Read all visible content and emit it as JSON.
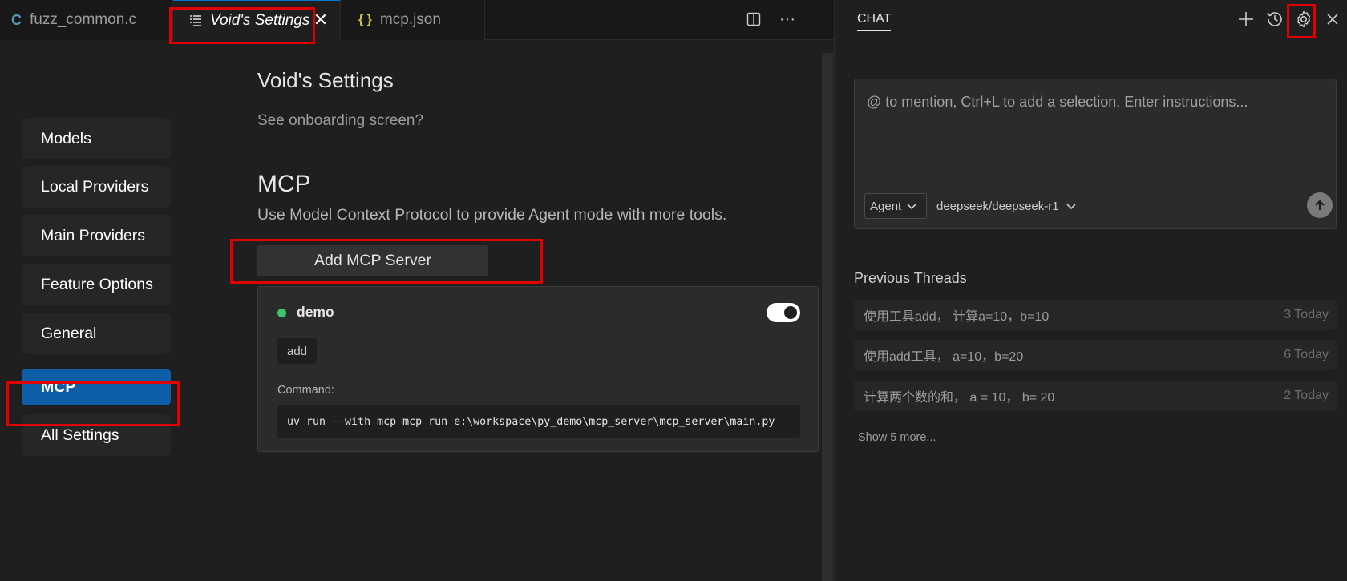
{
  "tabs": [
    {
      "label": "fuzz_common.c",
      "icon": "c-file-icon",
      "glyph": "C"
    },
    {
      "label": "Void's Settings",
      "icon": "settings-list-icon",
      "active": true
    },
    {
      "label": "mcp.json",
      "icon": "json-file-icon",
      "glyph": "{ }"
    }
  ],
  "editor_actions": {
    "split_icon": "split-editor-icon",
    "more_icon": "more-actions-icon",
    "more_glyph": "···"
  },
  "nav": {
    "items": [
      {
        "label": "Models"
      },
      {
        "label": "Local Providers"
      },
      {
        "label": "Main Providers"
      },
      {
        "label": "Feature Options"
      },
      {
        "label": "General"
      },
      {
        "label": "MCP",
        "active": true
      },
      {
        "label": "All Settings"
      }
    ]
  },
  "settings": {
    "title": "Void's Settings",
    "onboarding_link": "See onboarding screen?",
    "mcp_heading": "MCP",
    "mcp_description": "Use Model Context Protocol to provide Agent mode with more tools.",
    "add_button": "Add MCP Server",
    "server": {
      "name": "demo",
      "status_color": "#3ec46d",
      "enabled": true,
      "tools": [
        "add"
      ],
      "command_label": "Command:",
      "command": "uv run --with mcp mcp run e:\\workspace\\py_demo\\mcp_server\\mcp_server\\main.py"
    }
  },
  "chat": {
    "tab_label": "CHAT",
    "actions": [
      "new-chat-icon",
      "history-icon",
      "settings-gear-icon",
      "close-icon"
    ],
    "composer": {
      "placeholder": "@ to mention, Ctrl+L to add a selection. Enter instructions...",
      "mode": "Agent",
      "model": "deepseek/deepseek-r1"
    },
    "previous_threads_title": "Previous Threads",
    "threads": [
      {
        "title": "使用工具add， 计算a=10，b=10",
        "meta": "3 Today"
      },
      {
        "title": "使用add工具， a=10，b=20",
        "meta": "6 Today"
      },
      {
        "title": "计算两个数的和， a = 10， b= 20",
        "meta": "2 Today"
      }
    ],
    "show_more": "Show 5 more..."
  },
  "colors": {
    "accent": "#0e5fa8",
    "highlight": "#e00000",
    "status_green": "#3ec46d"
  }
}
